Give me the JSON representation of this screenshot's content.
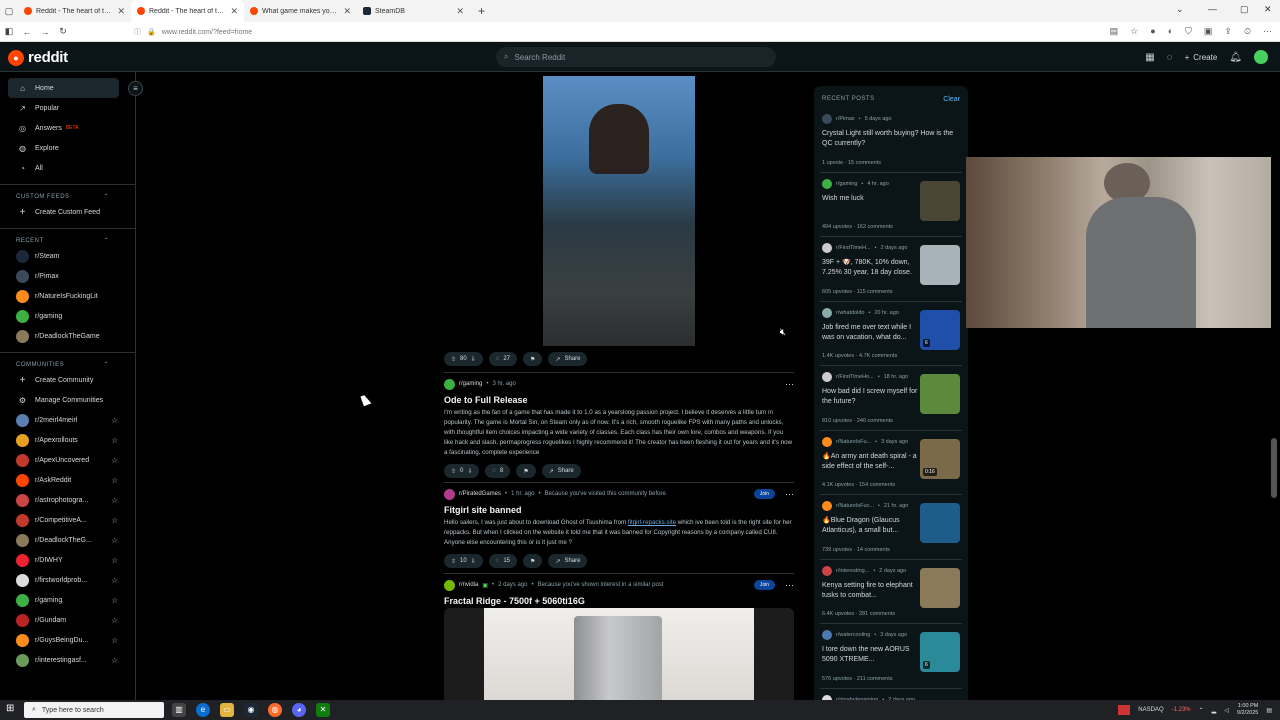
{
  "browser": {
    "tabs": [
      {
        "title": "Reddit - The heart of the intern",
        "active": false,
        "icon": "reddit"
      },
      {
        "title": "Reddit - The heart of the intern",
        "active": true,
        "icon": "reddit"
      },
      {
        "title": "What game makes you feel like",
        "active": false,
        "icon": "reddit"
      },
      {
        "title": "SteamDB",
        "active": false,
        "icon": "steam"
      }
    ],
    "url": "www.reddit.com/?feed=home"
  },
  "header": {
    "logo_text": "reddit",
    "search_placeholder": "Search Reddit",
    "create_label": "Create"
  },
  "sidebar": {
    "nav": [
      {
        "label": "Home",
        "icon": "home-icon",
        "active": true
      },
      {
        "label": "Popular",
        "icon": "popular-icon"
      },
      {
        "label": "Answers",
        "icon": "answers-icon",
        "badge": "BETA"
      },
      {
        "label": "Explore",
        "icon": "explore-icon"
      },
      {
        "label": "All",
        "icon": "all-icon"
      }
    ],
    "custom_feeds_title": "CUSTOM FEEDS",
    "create_custom_feed": "Create Custom Feed",
    "recent_title": "RECENT",
    "recent": [
      {
        "name": "r/Steam",
        "color": "#1b2838"
      },
      {
        "name": "r/Pimax",
        "color": "#3a4a5a"
      },
      {
        "name": "r/NatureIsFuckingLit",
        "color": "#ff8c1a"
      },
      {
        "name": "r/gaming",
        "color": "#3cb043"
      },
      {
        "name": "r/DeadlockTheGame",
        "color": "#8a7a5a"
      }
    ],
    "communities_title": "COMMUNITIES",
    "create_community": "Create Community",
    "manage_communities": "Manage Communities",
    "communities": [
      {
        "name": "r/2meirl4meirl",
        "color": "#5a7fb0"
      },
      {
        "name": "r/Apexrollouts",
        "color": "#e8a020"
      },
      {
        "name": "r/ApexUncovered",
        "color": "#c0392b"
      },
      {
        "name": "r/AskReddit",
        "color": "#ff4500"
      },
      {
        "name": "r/astrophotogra...",
        "color": "#c44"
      },
      {
        "name": "r/CompetitiveA...",
        "color": "#c0392b"
      },
      {
        "name": "r/DeadlockTheG...",
        "color": "#8a7a5a"
      },
      {
        "name": "r/DIWHY",
        "color": "#e23"
      },
      {
        "name": "r/firstworldprob...",
        "color": "#ddd"
      },
      {
        "name": "r/gaming",
        "color": "#3cb043"
      },
      {
        "name": "r/Gundam",
        "color": "#b22"
      },
      {
        "name": "r/GuysBeingDu...",
        "color": "#ff8c1a"
      },
      {
        "name": "r/interestingasf...",
        "color": "#6a9a5a"
      }
    ]
  },
  "feed": {
    "video_post": {
      "upvotes": "80",
      "comments": "27",
      "share": "Share"
    },
    "posts": [
      {
        "sub": "r/gaming",
        "time": "3 hr. ago",
        "sub_color": "#3cb043",
        "title": "Ode to Full Release",
        "body": "I'm writing as the fan of a game that has made it to 1.0 as a yearslong passion project. I believe it deserves a little turn in popularity. The game is Mortal Sin, on Steam only as of now. It's a rich, smooth roguelike FPS with many paths and unlocks, with thoughtful item choices impacting a wide variety of classes. Each class has their own lore, combos and weapons. If you like hack and slash, permaprogress roguelikes I highly recommend it! The creator has been fleshing it out for years and it's now a fascinating, complete experience",
        "upvotes": "0",
        "comments": "8",
        "share": "Share"
      },
      {
        "sub": "r/PiratedGames",
        "time": "1 hr. ago",
        "reason": "Because you've visited this community before",
        "sub_color": "#b03c8c",
        "title": "Fitgirl site banned",
        "body_pre": "Hello sailers, I was just about to download Ghost of Tsushima from ",
        "body_link": "fitgirl-repacks.site",
        "body_post": " which ive been told is the right site for her reppacks. But when I clicked on the website it told me that it was banned for Copyright reasons by a company called CUII. Anyone else encountering this or is it just me ?",
        "upvotes": "10",
        "comments": "15",
        "share": "Share",
        "join": "Join"
      },
      {
        "sub": "r/nvidia",
        "time": "2 days ago",
        "reason": "Because you've shown interest in a similar post",
        "sub_color": "#76b900",
        "title": "Fractal Ridge - 7500f + 5060ti16G",
        "join": "Join"
      }
    ]
  },
  "recent_posts": {
    "title": "RECENT POSTS",
    "clear": "Clear",
    "items": [
      {
        "sub": "r/Pimax",
        "time": "5 days ago",
        "title": "Crystal Light still worth buying? How is the QC currently?",
        "stats": "1 upvote · 15 comments",
        "thumb": null,
        "color": "#3a4a5a"
      },
      {
        "sub": "r/gaming",
        "time": "4 hr. ago",
        "title": "Wish me luck",
        "stats": "494 upvotes · 162 comments",
        "thumb": "#4a4636",
        "color": "#3cb043"
      },
      {
        "sub": "r/FirstTimeH...",
        "time": "2 days ago",
        "title": "39F + 🐶, 780K, 10% down, 7.25% 30 year, 18 day close.",
        "stats": "605 upvotes · 115 comments",
        "thumb": "#a7b3b9",
        "color": "#ccc"
      },
      {
        "sub": "r/whatdoldo",
        "time": "20 hr. ago",
        "title": "Job fired me over text while I was on vacation, what do...",
        "stats": "1.4K upvotes · 4.7K comments",
        "thumb": "#1f4fa8",
        "badge": "6",
        "color": "#8aa"
      },
      {
        "sub": "r/FirstTimeHo...",
        "time": "18 hr. ago",
        "title": "How bad did I screw myself for the future?",
        "stats": "810 upvotes · 240 comments",
        "thumb": "#5c8a3c",
        "color": "#ccc"
      },
      {
        "sub": "r/NatureIsFu...",
        "time": "3 days ago",
        "title": "🔥An army ant death spiral - a side effect of the self-...",
        "stats": "4.1K upvotes · 154 comments",
        "thumb": "#7a6a4a",
        "badge": "0:16",
        "color": "#ff8c1a"
      },
      {
        "sub": "r/NatureIsFuc...",
        "time": "21 hr. ago",
        "title": "🔥Blue Dragon (Glaucus Atlanticus), a small but...",
        "stats": "739 upvotes · 14 comments",
        "thumb": "#1e5c8a",
        "color": "#ff8c1a"
      },
      {
        "sub": "r/interesting...",
        "time": "2 days ago",
        "title": "Kenya setting fire to elephant tusks to combat...",
        "stats": "6.4K upvotes · 281 comments",
        "thumb": "#8a7a5a",
        "color": "#c44"
      },
      {
        "sub": "r/watercooling",
        "time": "3 days ago",
        "title": "I tore down the new AORUS 5090 XTREME...",
        "stats": "576 upvotes · 211 comments",
        "thumb": "#2a8a9a",
        "badge": "6",
        "color": "#4a7ab0"
      },
      {
        "sub": "r/gigabytegaming",
        "time": "2 days ago",
        "title": "",
        "stats": "",
        "thumb": null,
        "color": "#ddd"
      }
    ]
  },
  "taskbar": {
    "search_placeholder": "Type here to search",
    "ticker_name": "NASDAQ",
    "ticker_change": "-1.23%",
    "time": "1:00 PM",
    "date": "9/2/2025"
  }
}
